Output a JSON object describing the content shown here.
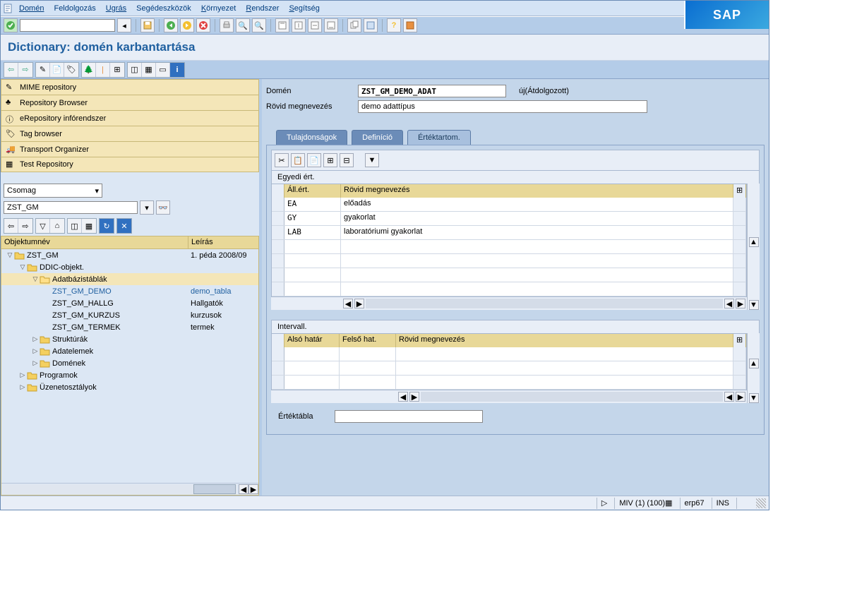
{
  "menu": {
    "items": [
      "Domén",
      "Feldolgozás",
      "Ugrás",
      "Segédeszközök",
      "Környezet",
      "Rendszer",
      "Segítség"
    ],
    "sap": "SAP"
  },
  "toolbar1": {
    "ok_icon": "check",
    "cmd": "",
    "buttons": [
      "back",
      "save",
      "back2",
      "exit",
      "cancel",
      "print",
      "find",
      "findnext",
      "firstpage",
      "prevpage",
      "nextpage",
      "lastpage",
      "newsession",
      "shortcut",
      "help",
      "custom"
    ]
  },
  "title": "Dictionary: domén karbantartása",
  "toolbar2": {
    "groups": [
      [
        "arrow-left",
        "arrow-right"
      ],
      [
        "pencil",
        "sheet",
        "hierarchy"
      ],
      [
        "tree1",
        "bar",
        "branch"
      ],
      [
        "org",
        "cube",
        "rect",
        "info"
      ]
    ]
  },
  "left": {
    "nav": [
      {
        "icon": "edit",
        "label": "MIME repository"
      },
      {
        "icon": "tree",
        "label": "Repository Browser"
      },
      {
        "icon": "info",
        "label": "eRepository infórendszer"
      },
      {
        "icon": "tag",
        "label": "Tag browser"
      },
      {
        "icon": "truck",
        "label": "Transport Organizer"
      },
      {
        "icon": "test",
        "label": "Test Repository"
      }
    ],
    "type_label": "Csomag",
    "package": "ZST_GM",
    "tree_hdr": {
      "name": "Objektumnév",
      "desc": "Leírás"
    },
    "tree": [
      {
        "lvl": 0,
        "exp": "▽",
        "icon": "folder",
        "name": "ZST_GM",
        "desc": "1. péda 2008/09"
      },
      {
        "lvl": 1,
        "exp": "▽",
        "icon": "folder",
        "name": "DDIC-objekt.",
        "desc": ""
      },
      {
        "lvl": 2,
        "exp": "▽",
        "icon": "folder-open",
        "name": "Adatbázistáblák",
        "desc": "",
        "sel": true
      },
      {
        "lvl": 3,
        "exp": "",
        "icon": "",
        "name": "ZST_GM_DEMO",
        "desc": "demo_tabla",
        "link": true
      },
      {
        "lvl": 3,
        "exp": "",
        "icon": "",
        "name": "ZST_GM_HALLG",
        "desc": "Hallgatók"
      },
      {
        "lvl": 3,
        "exp": "",
        "icon": "",
        "name": "ZST_GM_KURZUS",
        "desc": "kurzusok"
      },
      {
        "lvl": 3,
        "exp": "",
        "icon": "",
        "name": "ZST_GM_TERMEK",
        "desc": "termek"
      },
      {
        "lvl": 2,
        "exp": "▷",
        "icon": "folder",
        "name": "Struktúrák",
        "desc": ""
      },
      {
        "lvl": 2,
        "exp": "▷",
        "icon": "folder",
        "name": "Adatelemek",
        "desc": ""
      },
      {
        "lvl": 2,
        "exp": "▷",
        "icon": "folder",
        "name": "Domének",
        "desc": ""
      },
      {
        "lvl": 1,
        "exp": "▷",
        "icon": "folder",
        "name": "Programok",
        "desc": ""
      },
      {
        "lvl": 1,
        "exp": "▷",
        "icon": "folder",
        "name": "Üzenetosztályok",
        "desc": ""
      }
    ]
  },
  "form": {
    "domain_label": "Domén",
    "domain_value": "ZST_GM_DEMO_ADAT",
    "status": "új(Átdolgozott)",
    "short_label": "Rövid megnevezés",
    "short_value": "demo adattípus"
  },
  "tabs": [
    "Tulajdonságok",
    "Definíció",
    "Értéktartom."
  ],
  "active_tab": 2,
  "grid1": {
    "title": "Egyedi ért.",
    "cols": [
      "Áll.ért.",
      "Rövid megnevezés"
    ],
    "rows": [
      {
        "a": "EA",
        "b": "előadás"
      },
      {
        "a": "GY",
        "b": "gyakorlat"
      },
      {
        "a": "LAB",
        "b": "laboratóriumi gyakorlat"
      },
      {
        "a": "",
        "b": ""
      },
      {
        "a": "",
        "b": ""
      },
      {
        "a": "",
        "b": ""
      },
      {
        "a": "",
        "b": ""
      }
    ]
  },
  "grid2": {
    "title": "Intervall.",
    "cols": [
      "Alsó határ",
      "Felső hat.",
      "Rövid megnevezés"
    ],
    "rows": [
      {
        "a": "",
        "b": "",
        "c": ""
      },
      {
        "a": "",
        "b": "",
        "c": ""
      },
      {
        "a": "",
        "b": "",
        "c": ""
      }
    ]
  },
  "value_table": {
    "label": "Értéktábla",
    "value": ""
  },
  "status": {
    "sys": "MIV (1) (100)",
    "srv": "erp67",
    "mode": "INS"
  }
}
